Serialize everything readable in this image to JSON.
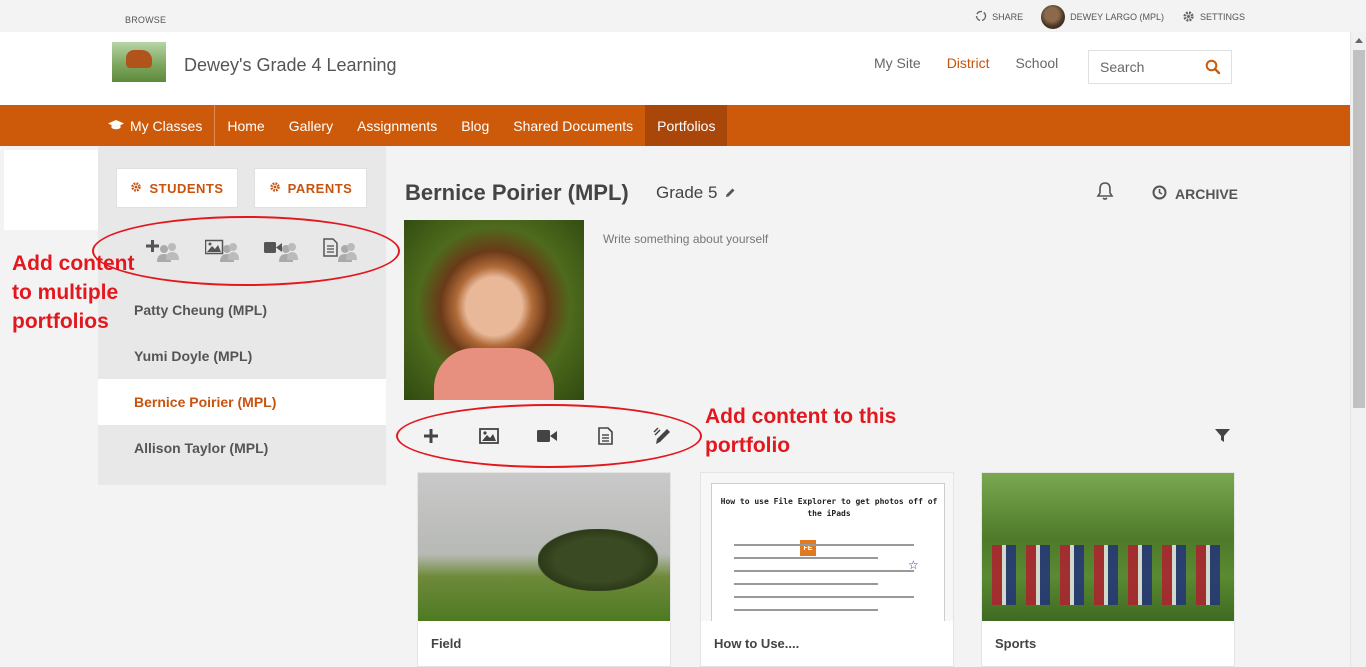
{
  "utility_bar": {
    "browse": "BROWSE",
    "share": "SHARE",
    "user": "DEWEY LARGO (MPL)",
    "settings": "SETTINGS"
  },
  "header": {
    "site_title": "Dewey's Grade 4 Learning",
    "nav": [
      "My Site",
      "District",
      "School"
    ],
    "active_nav": "District",
    "search_placeholder": "Search"
  },
  "main_nav": {
    "items": [
      "My Classes",
      "Home",
      "Gallery",
      "Assignments",
      "Blog",
      "Shared Documents",
      "Portfolios"
    ],
    "active": "Portfolios"
  },
  "sidebar": {
    "students_button": "STUDENTS",
    "parents_button": "PARENTS",
    "students": [
      "Patty Cheung (MPL)",
      "Yumi Doyle (MPL)",
      "Bernice Poirier (MPL)",
      "Allison Taylor (MPL)"
    ],
    "selected_student": "Bernice Poirier (MPL)"
  },
  "portfolio": {
    "name": "Bernice Poirier (MPL)",
    "grade": "Grade 5",
    "archive": "ARCHIVE",
    "about_placeholder": "Write something about yourself"
  },
  "cards": [
    {
      "title": "Field"
    },
    {
      "title": "How to Use....",
      "doc_title": "How to use File Explorer to get photos off of the iPads",
      "doc_badge": "FE"
    },
    {
      "title": "Sports"
    }
  ],
  "annotations": {
    "multi": "Add content to multiple portfolios",
    "single": "Add content to this portfolio"
  },
  "colors": {
    "brand": "#cd5a0a",
    "brand_dark": "#a9470a",
    "accent_text": "#c8530f",
    "annotation": "#e3181f"
  }
}
